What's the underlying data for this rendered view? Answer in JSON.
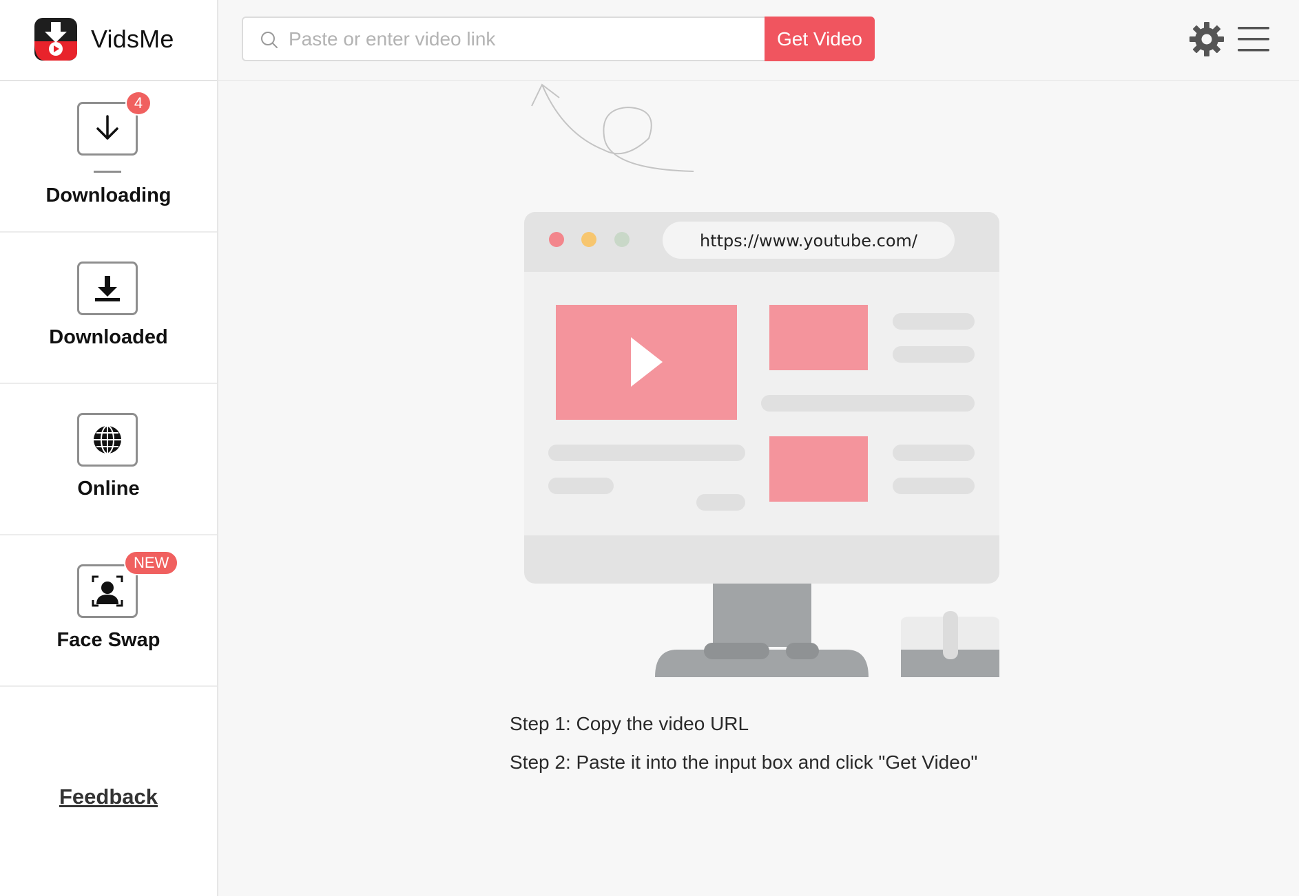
{
  "app": {
    "name": "VidsMe"
  },
  "sidebar": {
    "items": [
      {
        "label": "Downloading",
        "badge": "4"
      },
      {
        "label": "Downloaded"
      },
      {
        "label": "Online"
      },
      {
        "label": "Face Swap",
        "badge": "NEW"
      }
    ],
    "feedback": "Feedback"
  },
  "search": {
    "placeholder": "Paste or enter video link",
    "value": "",
    "button": "Get Video"
  },
  "illustration": {
    "url": "https://www.youtube.com/"
  },
  "steps": [
    "Step 1: Copy the video URL",
    "Step 2: Paste it into the input box and click \"Get Video\""
  ],
  "colors": {
    "accent": "#f0555f",
    "badge": "#f0605f",
    "video_block": "#f4949c"
  }
}
